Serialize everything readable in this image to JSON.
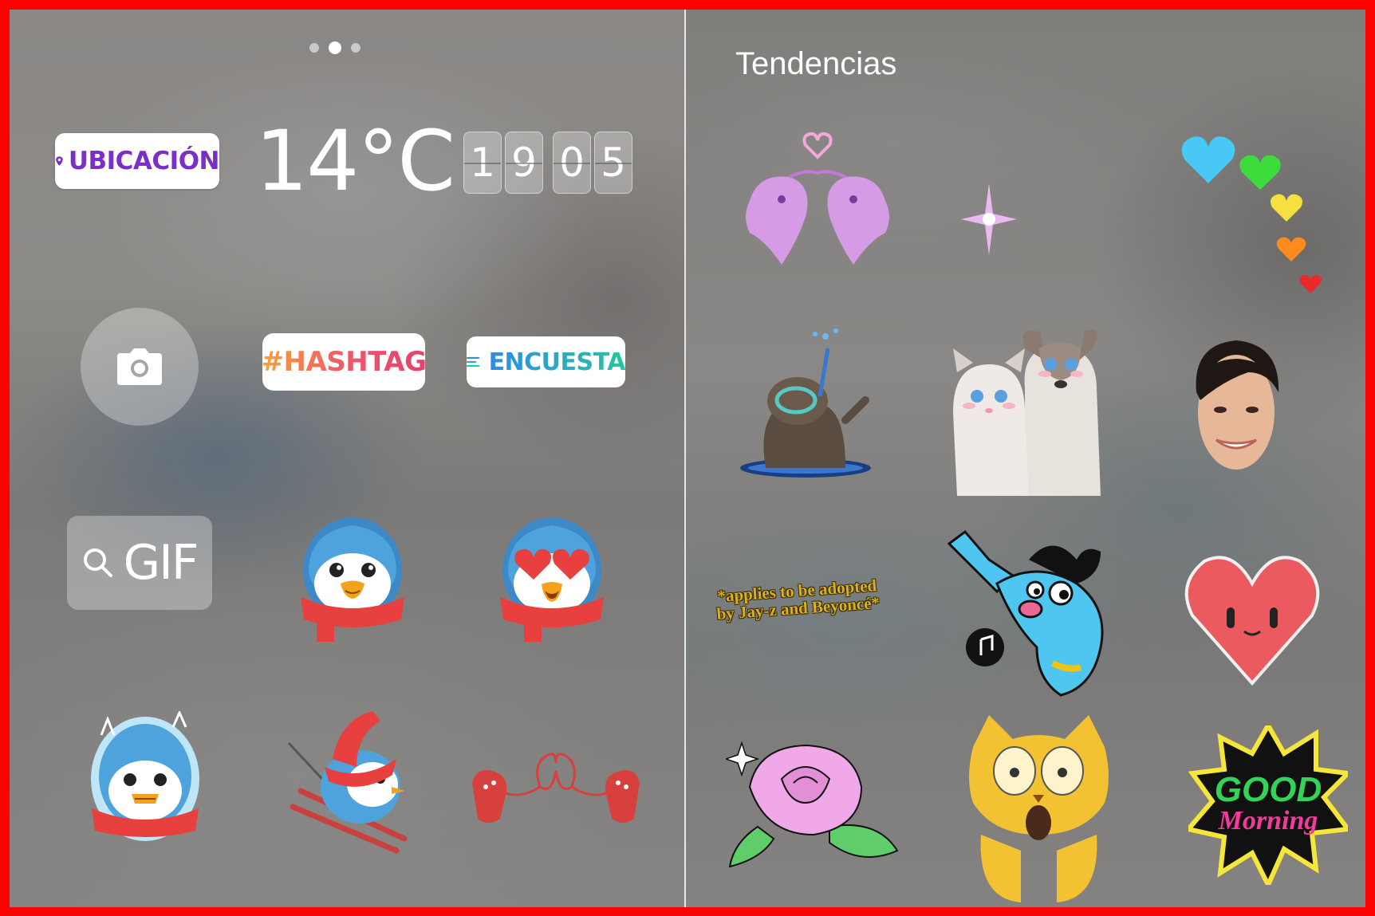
{
  "left_panel": {
    "page_dots": [
      false,
      true,
      false
    ],
    "location_sticker": {
      "label": "UBICACIÓN",
      "icon": "location-pin-icon",
      "color": "#7a2fc7"
    },
    "temperature_sticker": {
      "label": "14°C"
    },
    "clock_sticker": {
      "digits": [
        "1",
        "9",
        "0",
        "5"
      ]
    },
    "camera_sticker": {
      "icon": "camera-icon"
    },
    "hashtag_sticker": {
      "label": "#HASHTAG"
    },
    "poll_sticker": {
      "label": "ENCUESTA",
      "icon": "poll-lines-icon"
    },
    "gif_sticker": {
      "label": "GIF",
      "icon": "search-icon"
    },
    "stickers": [
      "penguin-scarf",
      "penguin-heart-eyes",
      "penguin-frozen",
      "penguin-skiing",
      "mittens-heart"
    ]
  },
  "right_panel": {
    "title": "Tendencias",
    "quote_sticker": {
      "text": "*applies to be adopted by Jay-z and Beyoncé*"
    },
    "good_morning_sticker": {
      "line1": "GOOD",
      "line2": "Morning"
    },
    "stickers": [
      "mermaids-heart",
      "sparkle",
      "rainbow-hearts",
      "otter-snorkel",
      "kitten-and-puppy",
      "woman-face",
      "blue-genie-singing",
      "red-heart-face",
      "pink-rose",
      "shocked-yellow-cat",
      "good-morning"
    ]
  }
}
